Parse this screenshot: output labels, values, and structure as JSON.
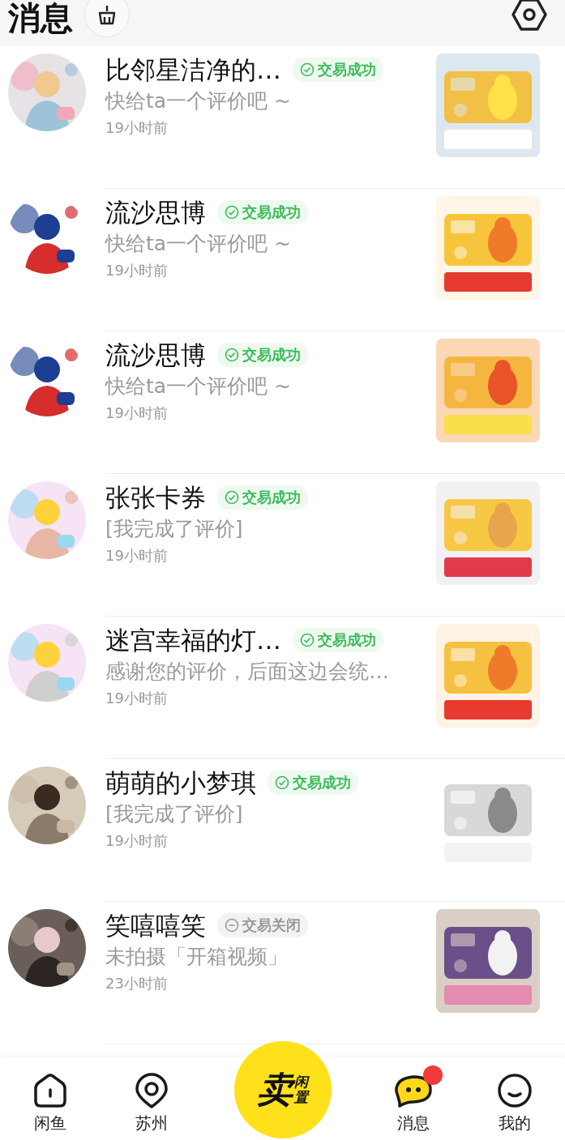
{
  "header": {
    "title": "消息"
  },
  "conversations": [
    {
      "name": "比邻星洁净的…",
      "status": {
        "kind": "success",
        "label": "交易成功"
      },
      "preview": "快给ta一个评价吧 ~",
      "time": "19小时前"
    },
    {
      "name": "流沙思博",
      "status": {
        "kind": "success",
        "label": "交易成功"
      },
      "preview": "快给ta一个评价吧 ~",
      "time": "19小时前"
    },
    {
      "name": "流沙思博",
      "status": {
        "kind": "success",
        "label": "交易成功"
      },
      "preview": "快给ta一个评价吧 ~",
      "time": "19小时前"
    },
    {
      "name": "张张卡券",
      "status": {
        "kind": "success",
        "label": "交易成功"
      },
      "preview": "[我完成了评价]",
      "time": "19小时前"
    },
    {
      "name": "迷宫幸福的灯…",
      "status": {
        "kind": "success",
        "label": "交易成功"
      },
      "preview": "感谢您的评价，后面这边会统…",
      "time": "19小时前"
    },
    {
      "name": "萌萌的小梦琪",
      "status": {
        "kind": "success",
        "label": "交易成功"
      },
      "preview": "[我完成了评价]",
      "time": "19小时前"
    },
    {
      "name": "笑嘻嘻笑",
      "status": {
        "kind": "closed",
        "label": "交易关闭"
      },
      "preview": "未拍摄「开箱视频」",
      "time": "23小时前"
    }
  ],
  "tab_bar": {
    "items": [
      {
        "kind": "home",
        "label": "闲鱼",
        "badge": false
      },
      {
        "kind": "location",
        "label": "苏州",
        "badge": false
      },
      {
        "kind": "messages",
        "label": "消息",
        "badge": true
      },
      {
        "kind": "profile",
        "label": "我的",
        "badge": false
      }
    ],
    "sell_button": {
      "main": "卖",
      "side": "闲置"
    }
  }
}
